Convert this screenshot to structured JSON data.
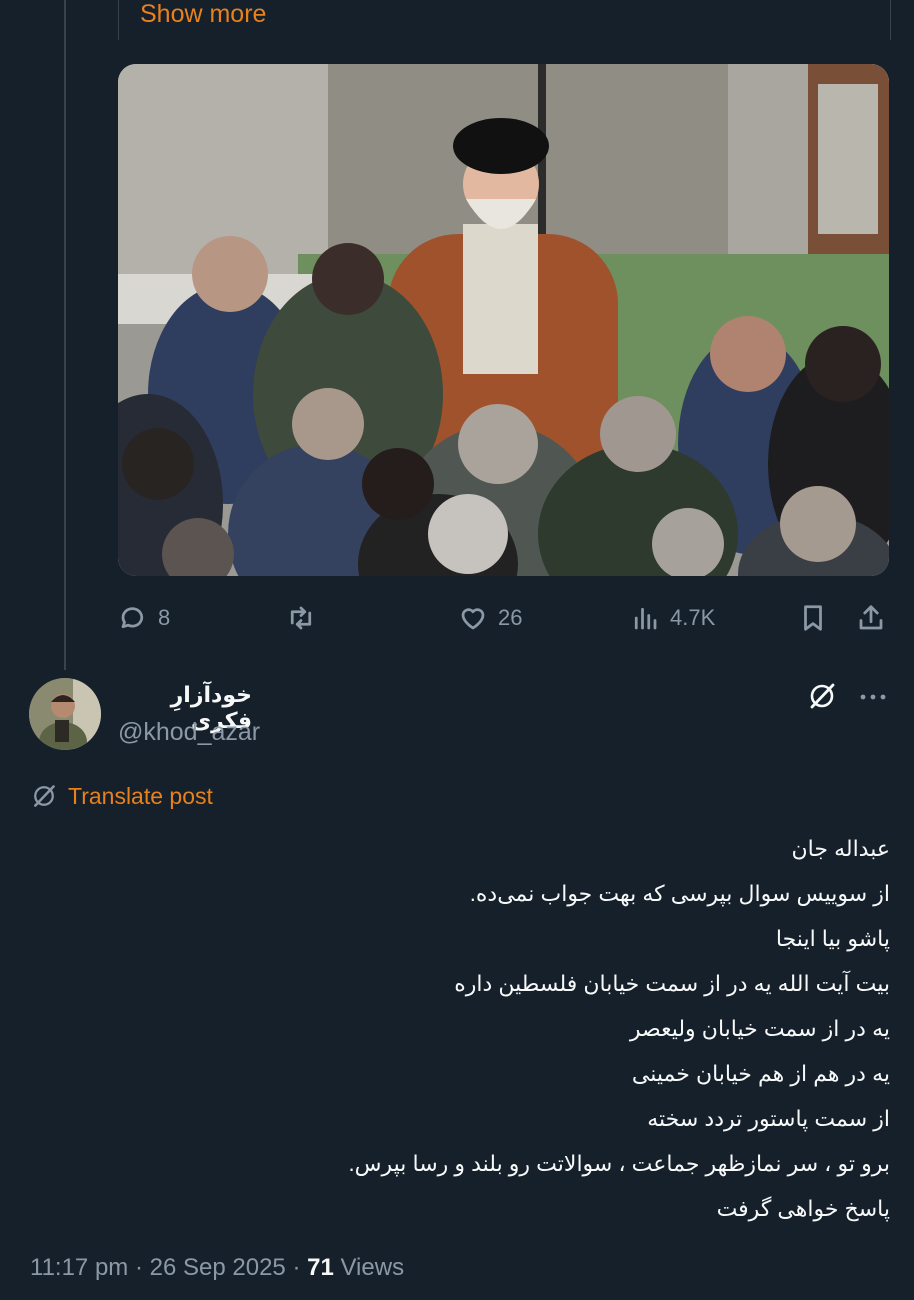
{
  "quoted": {
    "show_more_label": "Show more"
  },
  "actions": {
    "replies": "8",
    "reposts": "",
    "likes": "26",
    "views": "4.7K"
  },
  "reply": {
    "display_name": "خودآزارِ فکری",
    "handle": "@khod_azar",
    "translate_label": "Translate post",
    "lines": [
      "عبداله جان",
      "از سوییس سوال بپرسی که بهت جواب نمی‌ده.",
      "پاشو بیا اینجا",
      "بیت آیت الله یه در از سمت خیابان فلسطین داره",
      "یه در از سمت خیابان ولیعصر",
      "یه در هم از هم خیابان خمینی",
      "از سمت پاستور تردد سخته",
      "برو تو ، سر نمازظهر  جماعت ، سوالاتت رو بلند و رسا بپرس.",
      "پاسخ خواهی گرفت"
    ],
    "time": "11:17 pm",
    "date": "26 Sep 2025",
    "views_count": "71",
    "views_label": "Views"
  },
  "icons": [
    "reply-icon",
    "repost-icon",
    "like-icon",
    "views-icon",
    "bookmark-icon",
    "share-icon",
    "grok-icon",
    "more-icon",
    "translate-icon"
  ],
  "colors": {
    "background": "#15202b",
    "accent": "#e8811c",
    "muted": "#8b98a5",
    "text": "#f7f9f9"
  }
}
